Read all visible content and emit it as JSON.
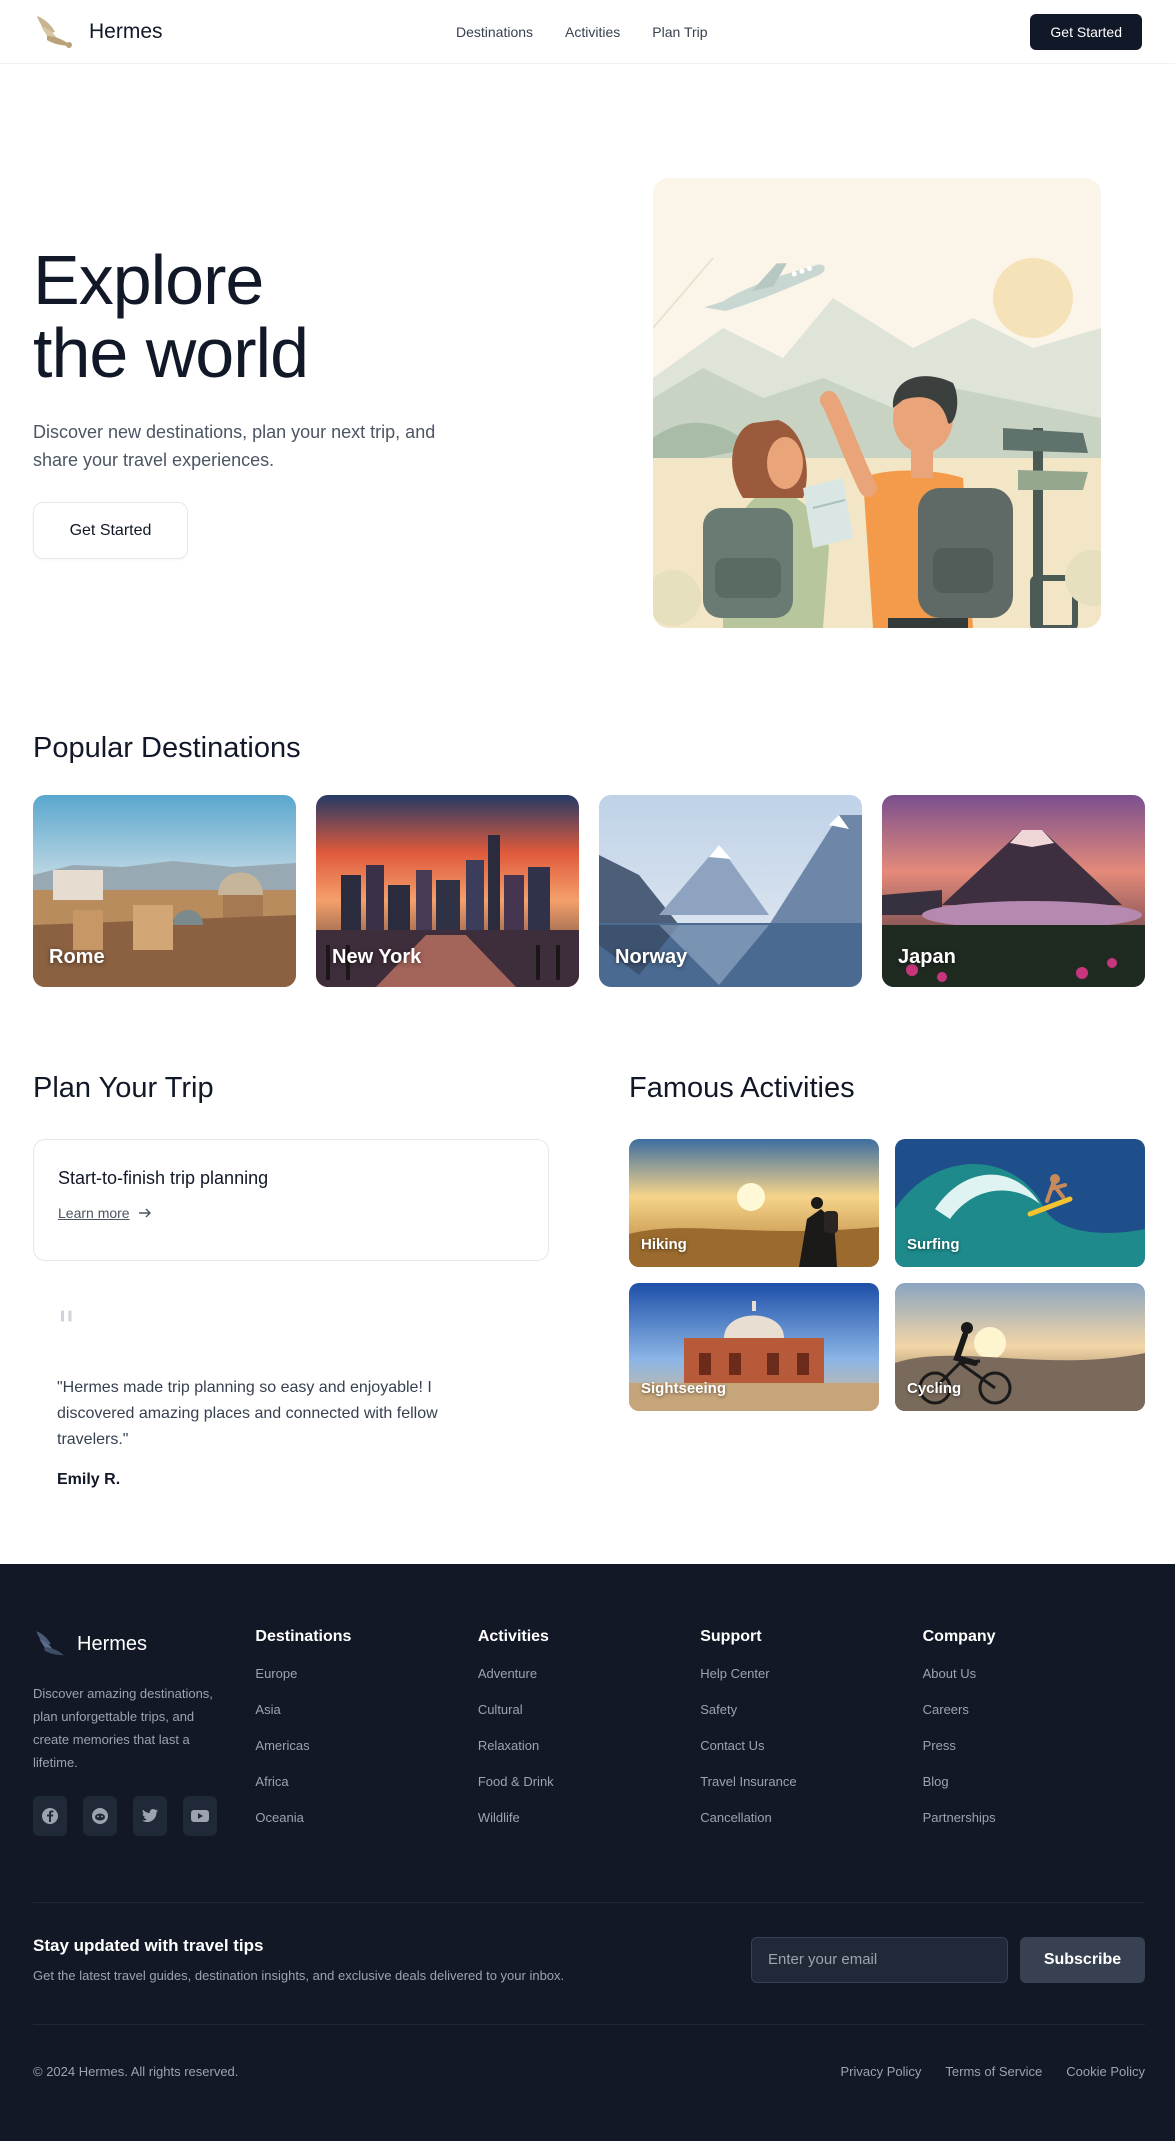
{
  "header": {
    "brand": "Hermes",
    "nav": [
      "Destinations",
      "Activities",
      "Plan Trip"
    ],
    "cta": "Get Started"
  },
  "hero": {
    "title_line1": "Explore",
    "title_line2": "the world",
    "subtitle": "Discover new destinations, plan your next trip, and share your travel experiences.",
    "cta": "Get Started"
  },
  "destinations": {
    "title": "Popular Destinations",
    "items": [
      {
        "name": "Rome"
      },
      {
        "name": "New York"
      },
      {
        "name": "Norway"
      },
      {
        "name": "Japan"
      }
    ]
  },
  "plan": {
    "title": "Plan Your Trip",
    "card_title": "Start-to-finish trip planning",
    "card_link": "Learn more",
    "quote": "\"Hermes made trip planning so easy and enjoyable! I discovered amazing places and connected with fellow travelers.\"",
    "author": "Emily R."
  },
  "activities": {
    "title": "Famous Activities",
    "items": [
      {
        "name": "Hiking"
      },
      {
        "name": "Surfing"
      },
      {
        "name": "Sightseeing"
      },
      {
        "name": "Cycling"
      }
    ]
  },
  "footer": {
    "brand": "Hermes",
    "description": "Discover amazing destinations, plan unforgettable trips, and create memories that last a lifetime.",
    "socials": [
      "facebook-icon",
      "reddit-icon",
      "twitter-icon",
      "youtube-icon"
    ],
    "columns": [
      {
        "title": "Destinations",
        "links": [
          "Europe",
          "Asia",
          "Americas",
          "Africa",
          "Oceania"
        ]
      },
      {
        "title": "Activities",
        "links": [
          "Adventure",
          "Cultural",
          "Relaxation",
          "Food & Drink",
          "Wildlife"
        ]
      },
      {
        "title": "Support",
        "links": [
          "Help Center",
          "Safety",
          "Contact Us",
          "Travel Insurance",
          "Cancellation"
        ]
      },
      {
        "title": "Company",
        "links": [
          "About Us",
          "Careers",
          "Press",
          "Blog",
          "Partnerships"
        ]
      }
    ],
    "newsletter": {
      "title": "Stay updated with travel tips",
      "subtitle": "Get the latest travel guides, destination insights, and exclusive deals delivered to your inbox.",
      "placeholder": "Enter your email",
      "button": "Subscribe"
    },
    "copyright": "© 2024 Hermes. All rights reserved.",
    "legal": [
      "Privacy Policy",
      "Terms of Service",
      "Cookie Policy"
    ]
  },
  "colors": {
    "primary_dark": "#111827",
    "footer_bg": "#121826",
    "muted_text": "#9ca3af"
  }
}
